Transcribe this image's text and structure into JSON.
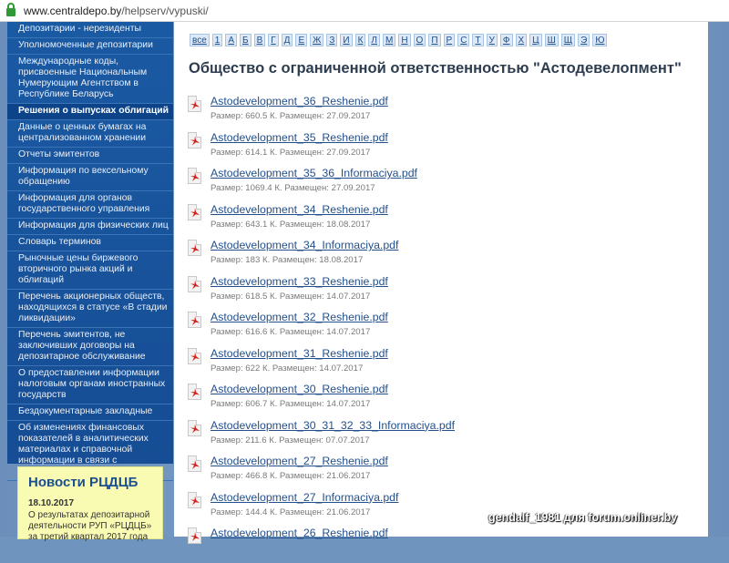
{
  "browser": {
    "url_host": "www.centraldepo.by",
    "url_path": "/helpserv/vypuski/"
  },
  "sidebar": {
    "items": [
      {
        "label": "Депозитарии - нерезиденты",
        "active": false
      },
      {
        "label": "Уполномоченные депозитарии",
        "active": false
      },
      {
        "label": "Международные коды, присвоенные Национальным Нумерующим Агентством в Республике Беларусь",
        "active": false
      },
      {
        "label": "Решения о выпусках облигаций",
        "active": true
      },
      {
        "label": "Данные о ценных бумагах на централизованном хранении",
        "active": false
      },
      {
        "label": "Отчеты эмитентов",
        "active": false
      },
      {
        "label": "Информация по вексельному обращению",
        "active": false
      },
      {
        "label": "Информация для органов государственного управления",
        "active": false
      },
      {
        "label": "Информация для физических лиц",
        "active": false
      },
      {
        "label": "Словарь терминов",
        "active": false
      },
      {
        "label": "Рыночные цены биржевого вторичного рынка акций и облигаций",
        "active": false
      },
      {
        "label": "Перечень акционерных обществ, находящихся в статусе «В стадии ликвидации»",
        "active": false
      },
      {
        "label": "Перечень эмитентов, не заключивших договоры на депозитарное обслуживание",
        "active": false
      },
      {
        "label": "О предоставлении информации налоговым органам иностранных государств",
        "active": false
      },
      {
        "label": "Бездокументарные закладные",
        "active": false
      },
      {
        "label": "Об изменениях финансовых показателей в аналитических материалах и справочной информации в связи с деноминацией",
        "active": false
      }
    ]
  },
  "news": {
    "title": "Новости РЦДЦБ",
    "date": "18.10.2017",
    "text": "О результатах депозитарной деятельности РУП «РЦДЦБ» за третий квартал 2017 года"
  },
  "alphabet": [
    "все",
    "1",
    "А",
    "Б",
    "В",
    "Г",
    "Д",
    "Е",
    "Ж",
    "З",
    "И",
    "К",
    "Л",
    "М",
    "Н",
    "О",
    "П",
    "Р",
    "С",
    "Т",
    "У",
    "Ф",
    "Х",
    "Ц",
    "Ш",
    "Щ",
    "Э",
    "Ю"
  ],
  "main": {
    "title": "Общество с ограниченной ответственностью \"Астодевелопмент\"",
    "files": [
      {
        "name": "Astodevelopment_36_Reshenie.pdf",
        "meta": "Размер: 660.5 К. Размещен: 27.09.2017"
      },
      {
        "name": "Astodevelopment_35_Reshenie.pdf",
        "meta": "Размер: 614.1 К. Размещен: 27.09.2017"
      },
      {
        "name": "Astodevelopment_35_36_Informaciya.pdf",
        "meta": "Размер: 1069.4 К. Размещен: 27.09.2017"
      },
      {
        "name": "Astodevelopment_34_Reshenie.pdf",
        "meta": "Размер: 643.1 К. Размещен: 18.08.2017"
      },
      {
        "name": "Astodevelopment_34_Informaciya.pdf",
        "meta": "Размер: 183 К. Размещен: 18.08.2017"
      },
      {
        "name": "Astodevelopment_33_Reshenie.pdf",
        "meta": "Размер: 618.5 К. Размещен: 14.07.2017"
      },
      {
        "name": "Astodevelopment_32_Reshenie.pdf",
        "meta": "Размер: 616.6 К. Размещен: 14.07.2017"
      },
      {
        "name": "Astodevelopment_31_Reshenie.pdf",
        "meta": "Размер: 622 К. Размещен: 14.07.2017"
      },
      {
        "name": "Astodevelopment_30_Reshenie.pdf",
        "meta": "Размер: 606.7 К. Размещен: 14.07.2017"
      },
      {
        "name": "Astodevelopment_30_31_32_33_Informaciya.pdf",
        "meta": "Размер: 211.6 К. Размещен: 07.07.2017"
      },
      {
        "name": "Astodevelopment_27_Reshenie.pdf",
        "meta": "Размер: 466.8 К. Размещен: 21.06.2017"
      },
      {
        "name": "Astodevelopment_27_Informaciya.pdf",
        "meta": "Размер: 144.4 К. Размещен: 21.06.2017"
      },
      {
        "name": "Astodevelopment_26_Reshenie.pdf",
        "meta": ""
      }
    ]
  },
  "watermark": "gendalf_1981 для forum.onliner.by"
}
